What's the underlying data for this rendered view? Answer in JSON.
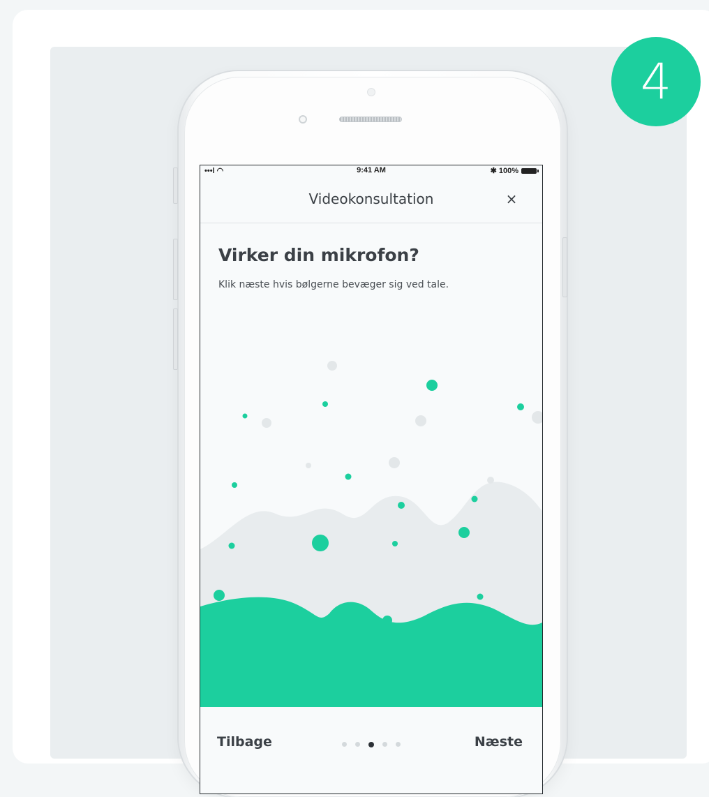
{
  "step": {
    "number": "4"
  },
  "status_bar": {
    "signal": "•••l ◠",
    "time": "9:41 AM",
    "battery": "✱ 100%"
  },
  "header": {
    "title": "Videokonsultation",
    "close_label": "×"
  },
  "content": {
    "title": "Virker din mikrofon?",
    "subtitle": "Klik næste hvis bølgerne bevæger sig ved tale."
  },
  "footer": {
    "back_label": "Tilbage",
    "next_label": "Næste",
    "pages_total": 5,
    "active_page": 3
  },
  "colors": {
    "accent": "#1ccf9e",
    "wave_back": "#e8ecee",
    "text_dark": "#3b4046",
    "dot_grey": "#e3e7e9"
  },
  "icons": {
    "close": "close-icon",
    "signal": "signal-icon",
    "battery": "battery-icon"
  }
}
